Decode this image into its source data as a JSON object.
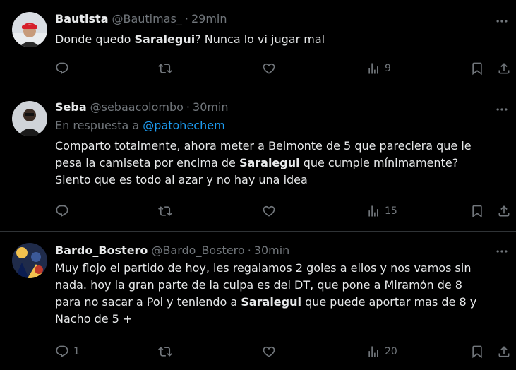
{
  "tweets": [
    {
      "name": "Bautista",
      "handle": "@Bautimas_",
      "dot": "·",
      "time": "29min",
      "text_parts": [
        "Donde quedo ",
        "Saralegui",
        "? Nunca lo vi jugar mal"
      ],
      "replies": "",
      "views": "9"
    },
    {
      "name": "Seba",
      "handle": "@sebaacolombo",
      "dot": "·",
      "time": "30min",
      "reply_prefix": "En respuesta a ",
      "reply_mention": "@patohechem",
      "text_parts": [
        "Comparto totalmente, ahora meter a Belmonte de 5 que pareciera que le pesa la camiseta por encima de ",
        "Saralegui",
        " que cumple mínimamente? Siento que es todo al azar y no hay una idea"
      ],
      "replies": "",
      "views": "15"
    },
    {
      "name": "Bardo_Bostero",
      "handle": "@Bardo_Bostero",
      "dot": "·",
      "time": "30min",
      "text_parts": [
        "Muy flojo el partido de hoy, les regalamos 2 goles a ellos y nos vamos sin nada. hoy la gran parte de la culpa es del DT, que pone a Miramón de 8 para no sacar a Pol y teniendo a ",
        "Saralegui",
        " que puede aportar mas de 8 y Nacho de 5 +"
      ],
      "replies": "1",
      "views": "20"
    }
  ],
  "icons": {
    "reply": "reply-icon",
    "repost": "repost-icon",
    "like": "like-icon",
    "views": "views-icon",
    "bookmark": "bookmark-icon",
    "share": "share-icon",
    "more": "more-icon"
  },
  "colors": {
    "background": "#000000",
    "text": "#e7e9ea",
    "muted": "#71767b",
    "link": "#1d9bf0",
    "divider": "#2f3336"
  }
}
